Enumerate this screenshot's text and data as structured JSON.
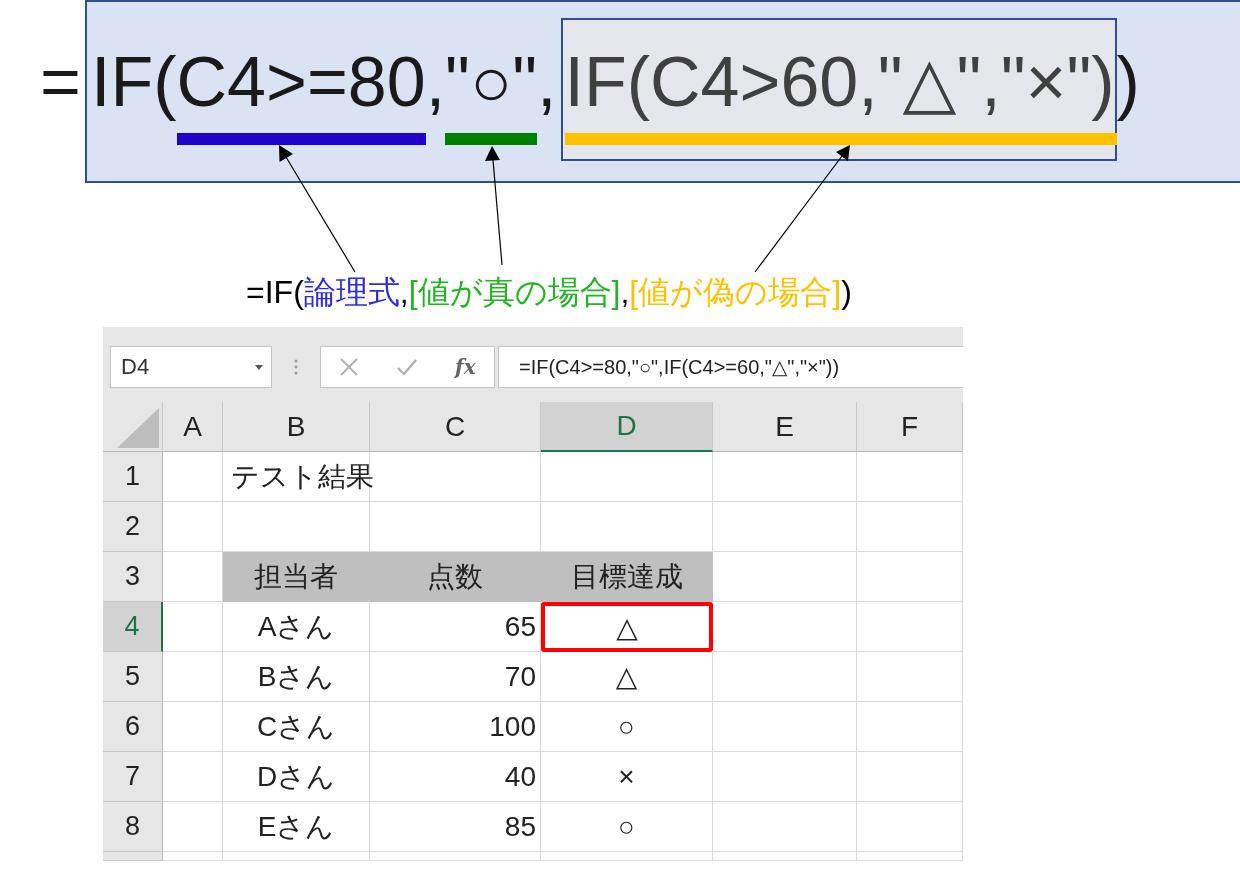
{
  "formula_diagram": {
    "prefix": "=",
    "segments": [
      {
        "text": "IF(",
        "kind": "plain"
      },
      {
        "text": "C4>=80",
        "kind": "condition",
        "color": "#2200cc"
      },
      {
        "text": ",",
        "kind": "plain"
      },
      {
        "text": "\"○\"",
        "kind": "true_value",
        "color": "#008000"
      },
      {
        "text": ",",
        "kind": "plain"
      },
      {
        "text": "IF(C4>60,\"△\",\"×\")",
        "kind": "false_value",
        "color": "#ffc000"
      },
      {
        "text": ")",
        "kind": "plain"
      }
    ]
  },
  "syntax_caption": [
    {
      "text": "=IF(",
      "color": "#000000"
    },
    {
      "text": "論理式",
      "color": "#2b2bd9"
    },
    {
      "text": ",",
      "color": "#000000"
    },
    {
      "text": "[値が真の場合]",
      "color": "#22b522"
    },
    {
      "text": ",",
      "color": "#000000"
    },
    {
      "text": "[値が偽の場合]",
      "color": "#ffc000"
    },
    {
      "text": ")",
      "color": "#000000"
    }
  ],
  "spreadsheet": {
    "name_box": "D4",
    "function_label": "fx",
    "formula": "=IF(C4>=80,\"○\",IF(C4>=60,\"△\",\"×\"))",
    "columns": [
      {
        "label": "A",
        "selected": false
      },
      {
        "label": "B",
        "selected": false
      },
      {
        "label": "C",
        "selected": false
      },
      {
        "label": "D",
        "selected": true
      },
      {
        "label": "E",
        "selected": false
      },
      {
        "label": "F",
        "selected": false
      }
    ],
    "row_headers": [
      {
        "label": "1",
        "selected": false
      },
      {
        "label": "2",
        "selected": false
      },
      {
        "label": "3",
        "selected": false
      },
      {
        "label": "4",
        "selected": true
      },
      {
        "label": "5",
        "selected": false
      },
      {
        "label": "6",
        "selected": false
      },
      {
        "label": "7",
        "selected": false
      },
      {
        "label": "8",
        "selected": false
      }
    ],
    "title": "テスト結果",
    "header": [
      "担当者",
      "点数",
      "目標達成"
    ],
    "records": [
      {
        "name": "Aさん",
        "score": "65",
        "result": "△",
        "selected": true
      },
      {
        "name": "Bさん",
        "score": "70",
        "result": "△",
        "selected": false
      },
      {
        "name": "Cさん",
        "score": "100",
        "result": "○",
        "selected": false
      },
      {
        "name": "Dさん",
        "score": "40",
        "result": "×",
        "selected": false
      },
      {
        "name": "Eさん",
        "score": "85",
        "result": "○",
        "selected": false
      }
    ]
  }
}
